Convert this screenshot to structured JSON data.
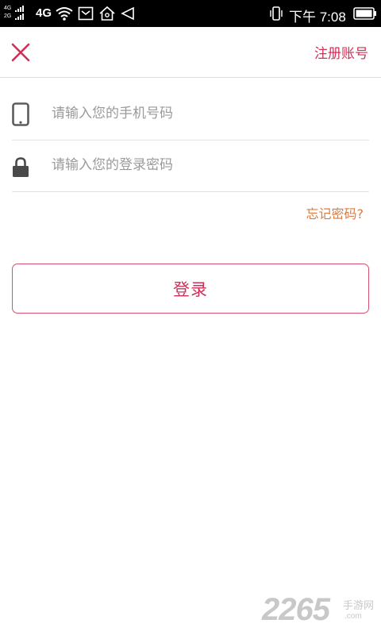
{
  "status_bar": {
    "signal_1_label": "4G",
    "signal_2_label": "2G",
    "network_label": "4G",
    "time": "下午 7:08"
  },
  "header": {
    "register_label": "注册账号"
  },
  "form": {
    "phone_placeholder": "请输入您的手机号码",
    "phone_value": "",
    "password_placeholder": "请输入您的登录密码",
    "password_value": "",
    "forgot_label": "忘记密码?",
    "login_label": "登录"
  },
  "watermark": {
    "number": "2265",
    "text": "手游网",
    "domain": ".com"
  },
  "colors": {
    "accent": "#d03058",
    "forgot": "#e07a3c",
    "divider": "#e3e3e3"
  }
}
